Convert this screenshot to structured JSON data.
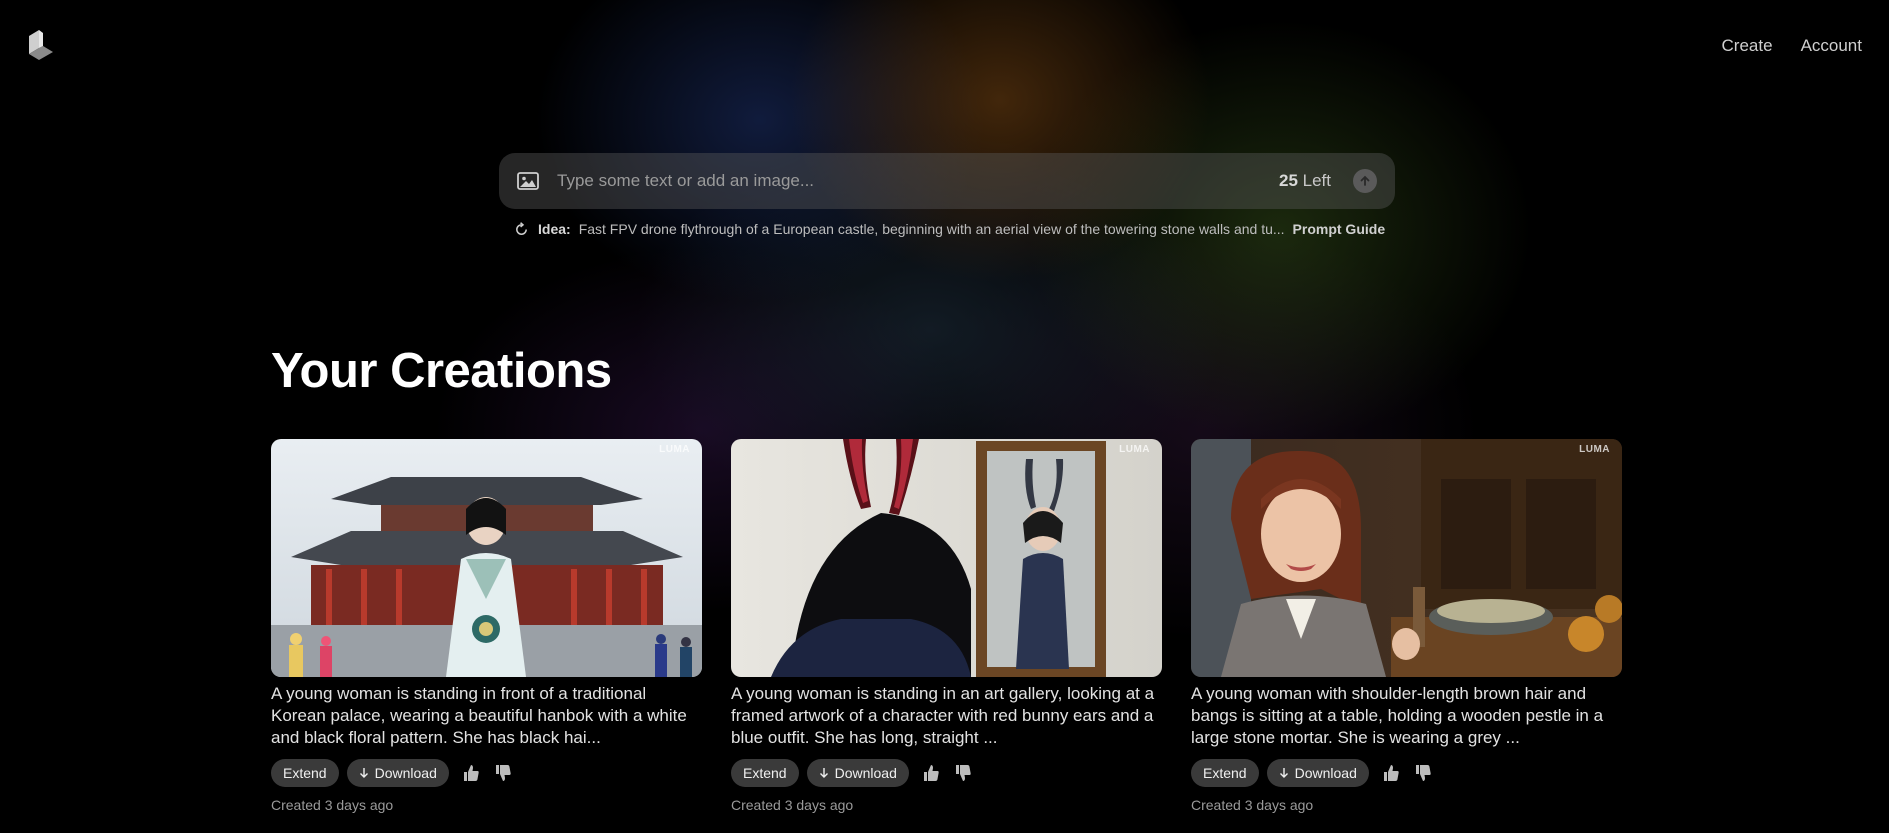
{
  "header": {
    "logo_icon": "luma-logo-icon",
    "nav": [
      {
        "label": "Create"
      },
      {
        "label": "Account"
      }
    ]
  },
  "prompt": {
    "placeholder": "Type some text or add an image...",
    "value": "",
    "credits_count": "25",
    "credits_label": "Left",
    "image_icon": "image-icon",
    "submit_icon": "arrow-up-icon"
  },
  "idea": {
    "label": "Idea:",
    "text": "Fast FPV drone flythrough of a European castle, beginning with an aerial view of the towering stone walls and tu...",
    "guide_label": "Prompt Guide",
    "refresh_icon": "refresh-icon"
  },
  "section": {
    "title": "Your Creations"
  },
  "creations": [
    {
      "watermark": "LUMA",
      "caption": "A young woman is standing in front of a traditional Korean palace, wearing a beautiful hanbok with a white and black floral pattern. She has black hai...",
      "extend_label": "Extend",
      "download_label": "Download",
      "created": "Created 3 days ago"
    },
    {
      "watermark": "LUMA",
      "caption": "A young woman is standing in an art gallery, looking at a framed artwork of a character with red bunny ears and a blue outfit. She has long, straight ...",
      "extend_label": "Extend",
      "download_label": "Download",
      "created": "Created 3 days ago"
    },
    {
      "watermark": "LUMA",
      "caption": "A young woman with shoulder-length brown hair and bangs is sitting at a table, holding a wooden pestle in a large stone mortar. She is wearing a grey ...",
      "extend_label": "Extend",
      "download_label": "Download",
      "created": "Created 3 days ago"
    }
  ],
  "colors": {
    "background": "#000000",
    "pill": "#3a3a3a",
    "prompt_bar": "#4a4a4a"
  }
}
